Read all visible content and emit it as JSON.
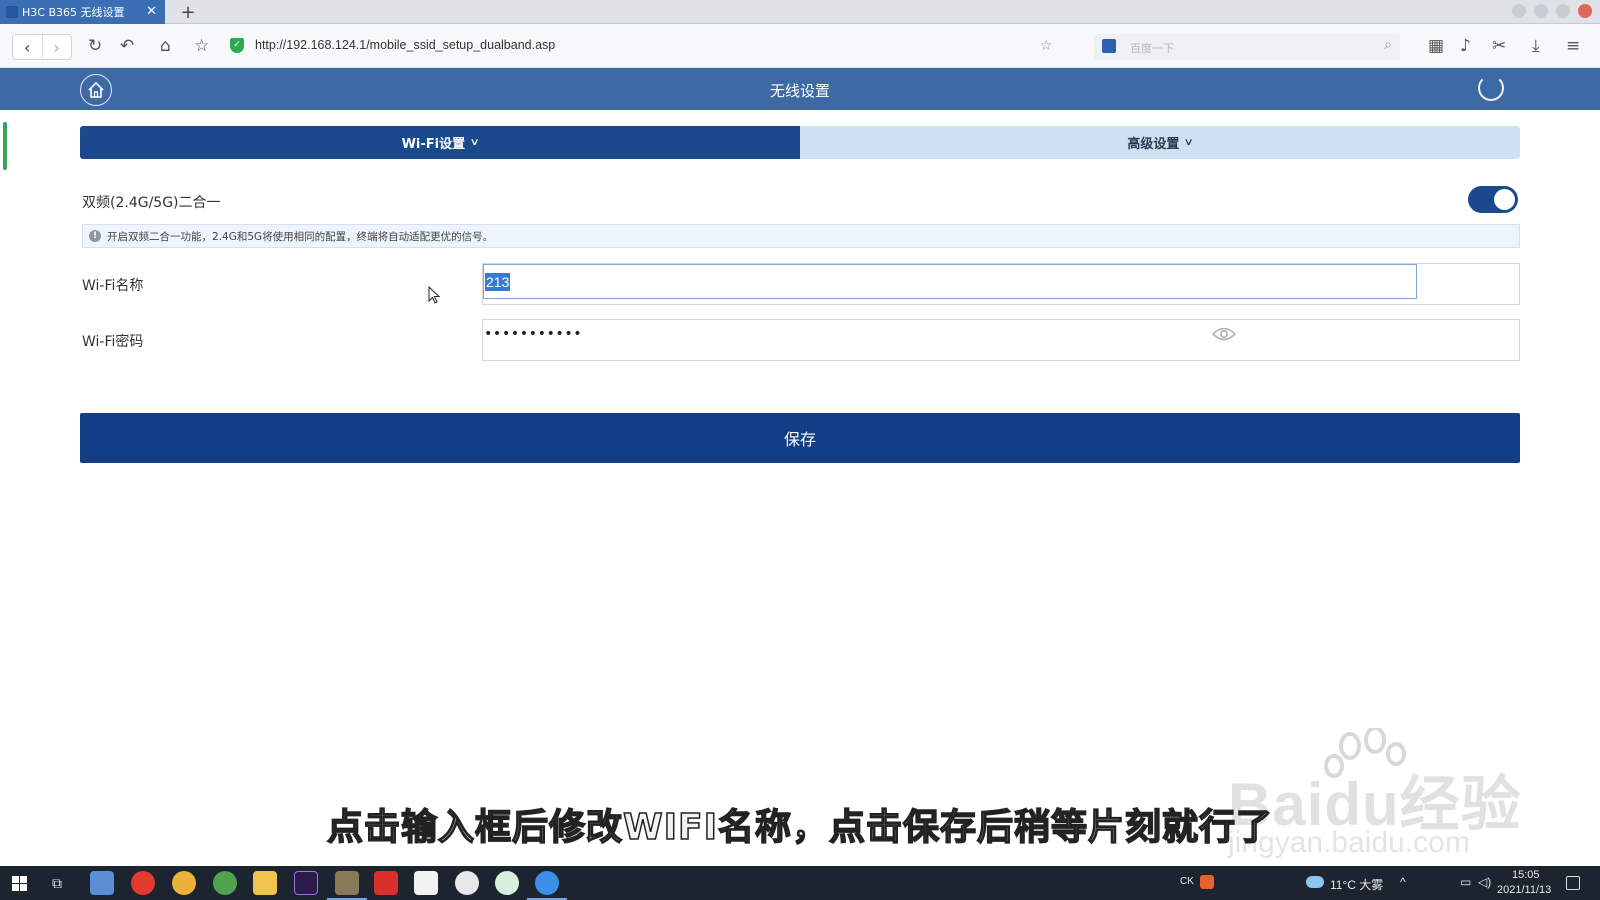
{
  "browser": {
    "tab_title": "H3C B365 无线设置",
    "tab_close": "✕",
    "new_tab": "+",
    "url": "http://192.168.124.1/mobile_ssid_setup_dualband.asp",
    "search_placeholder": "百度一下"
  },
  "header": {
    "title": "无线设置"
  },
  "tabs": [
    {
      "label": "Wi-Fi设置",
      "active": true
    },
    {
      "label": "高级设置",
      "active": false
    }
  ],
  "dualband": {
    "label": "双频(2.4G/5G)二合一",
    "enabled": true,
    "info": "开启双频二合一功能，2.4G和5G将使用相同的配置，终端将自动适配更优的信号。"
  },
  "form": {
    "ssid_label": "Wi-Fi名称",
    "ssid_value": "213",
    "password_label": "Wi-Fi密码",
    "password_mask": "•••••••••••"
  },
  "save_label": "保存",
  "subtitle": "点击输入框后修改WIFI名称，点击保存后稍等片刻就行了",
  "watermark": {
    "brand": "Baidu经验",
    "domain": "jingyan.baidu.com"
  },
  "taskbar": {
    "weather": "11°C 大雾",
    "time": "15:05",
    "date": "2021/11/13",
    "ime": "CK"
  },
  "colors": {
    "header": "#3d6aa5",
    "primary": "#1a4a8d",
    "tab_inactive": "#cfe0f3"
  }
}
